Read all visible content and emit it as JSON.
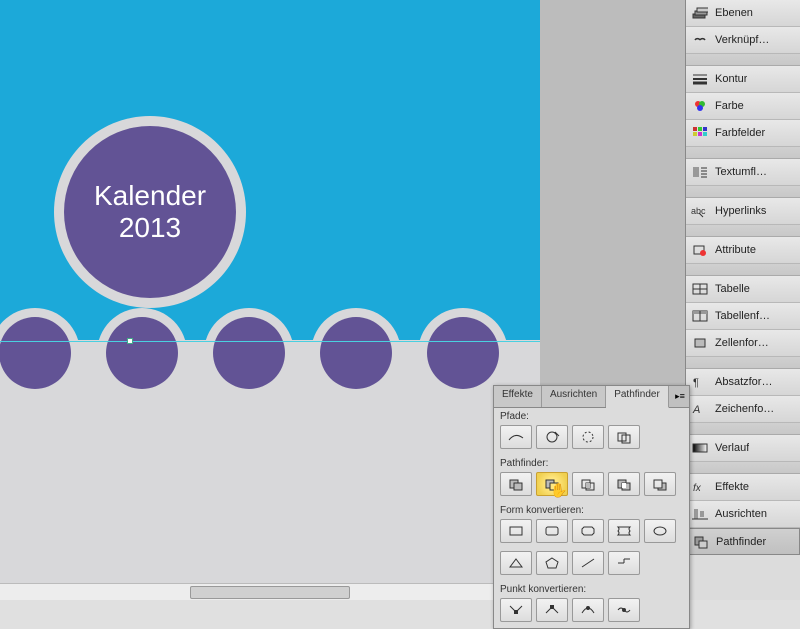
{
  "artboard": {
    "title_line1": "Kalender",
    "title_line2": "2013"
  },
  "sidebar": {
    "items": [
      {
        "label": "Ebenen",
        "icon": "layers"
      },
      {
        "label": "Verknüpf…",
        "icon": "links"
      },
      {
        "sep": true
      },
      {
        "label": "Kontur",
        "icon": "stroke"
      },
      {
        "label": "Farbe",
        "icon": "color"
      },
      {
        "label": "Farbfelder",
        "icon": "swatches"
      },
      {
        "sep": true
      },
      {
        "label": "Textumfl…",
        "icon": "textwrap"
      },
      {
        "sep": true
      },
      {
        "label": "Hyperlinks",
        "icon": "hyperlinks"
      },
      {
        "sep": true
      },
      {
        "label": "Attribute",
        "icon": "attributes"
      },
      {
        "sep": true
      },
      {
        "label": "Tabelle",
        "icon": "table"
      },
      {
        "label": "Tabellenf…",
        "icon": "tablestyles"
      },
      {
        "label": "Zellenfor…",
        "icon": "cellstyles"
      },
      {
        "sep": true
      },
      {
        "label": "Absatzfor…",
        "icon": "parastyles"
      },
      {
        "label": "Zeichenfo…",
        "icon": "charstyles"
      },
      {
        "sep": true
      },
      {
        "label": "Verlauf",
        "icon": "gradient"
      },
      {
        "sep": true
      },
      {
        "label": "Effekte",
        "icon": "effects"
      },
      {
        "label": "Ausrichten",
        "icon": "align"
      },
      {
        "label": "Pathfinder",
        "icon": "pathfinder",
        "active": true
      }
    ]
  },
  "pathfinder_panel": {
    "tabs": [
      "Effekte",
      "Ausrichten",
      "Pathfinder"
    ],
    "active_tab": 2,
    "sections": {
      "paths": "Pfade:",
      "pathfinder": "Pathfinder:",
      "convert_shape": "Form konvertieren:",
      "convert_point": "Punkt konvertieren:"
    }
  }
}
